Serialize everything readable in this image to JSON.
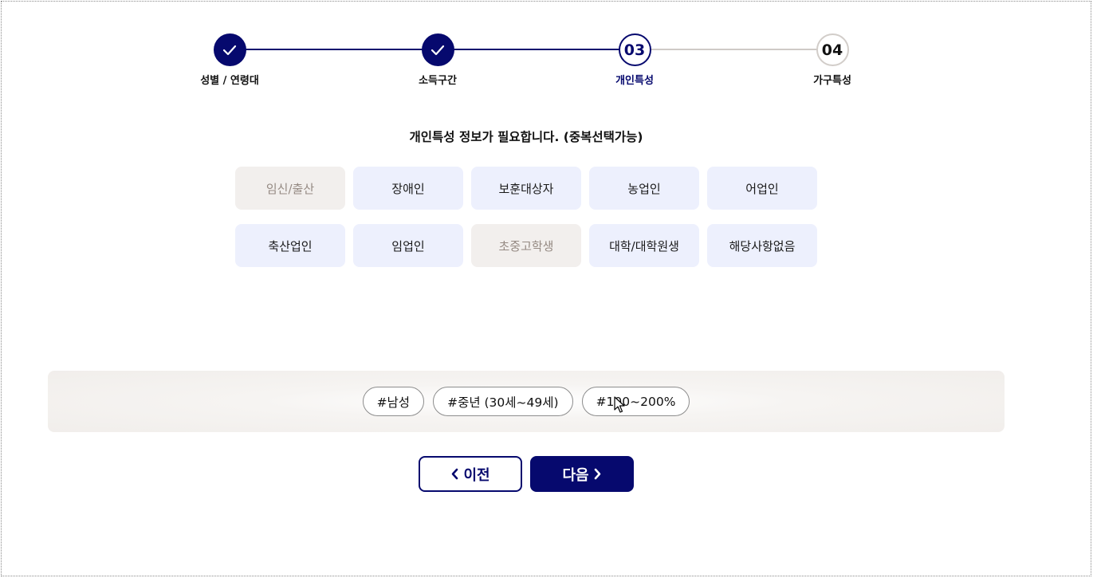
{
  "steps": [
    {
      "label": "성별 / 연령대",
      "state": "done",
      "number": ""
    },
    {
      "label": "소득구간",
      "state": "done",
      "number": ""
    },
    {
      "label": "개인특성",
      "state": "current",
      "number": "03"
    },
    {
      "label": "가구특성",
      "state": "todo",
      "number": "04"
    }
  ],
  "question": "개인특성 정보가 필요합니다. (중복선택가능)",
  "options": [
    {
      "label": "임신/출산",
      "disabled": true
    },
    {
      "label": "장애인",
      "disabled": false
    },
    {
      "label": "보훈대상자",
      "disabled": false
    },
    {
      "label": "농업인",
      "disabled": false
    },
    {
      "label": "어업인",
      "disabled": false
    },
    {
      "label": "축산업인",
      "disabled": false
    },
    {
      "label": "임업인",
      "disabled": false
    },
    {
      "label": "초중고학생",
      "disabled": true
    },
    {
      "label": "대학/대학원생",
      "disabled": false
    },
    {
      "label": "해당사항없음",
      "disabled": false
    }
  ],
  "tags": [
    "#남성",
    "#중년 (30세~49세)",
    "#100~200%"
  ],
  "nav": {
    "prev_label": "이전",
    "next_label": "다음"
  },
  "colors": {
    "primary": "#06096e",
    "option_bg": "#edf0fd",
    "option_disabled_bg": "#f2efed",
    "pending_line": "#cfcac6"
  },
  "icons": {
    "done_step": "check-icon",
    "prev": "chevron-left-icon",
    "next": "chevron-right-icon",
    "cursor": "mouse-pointer-icon"
  }
}
